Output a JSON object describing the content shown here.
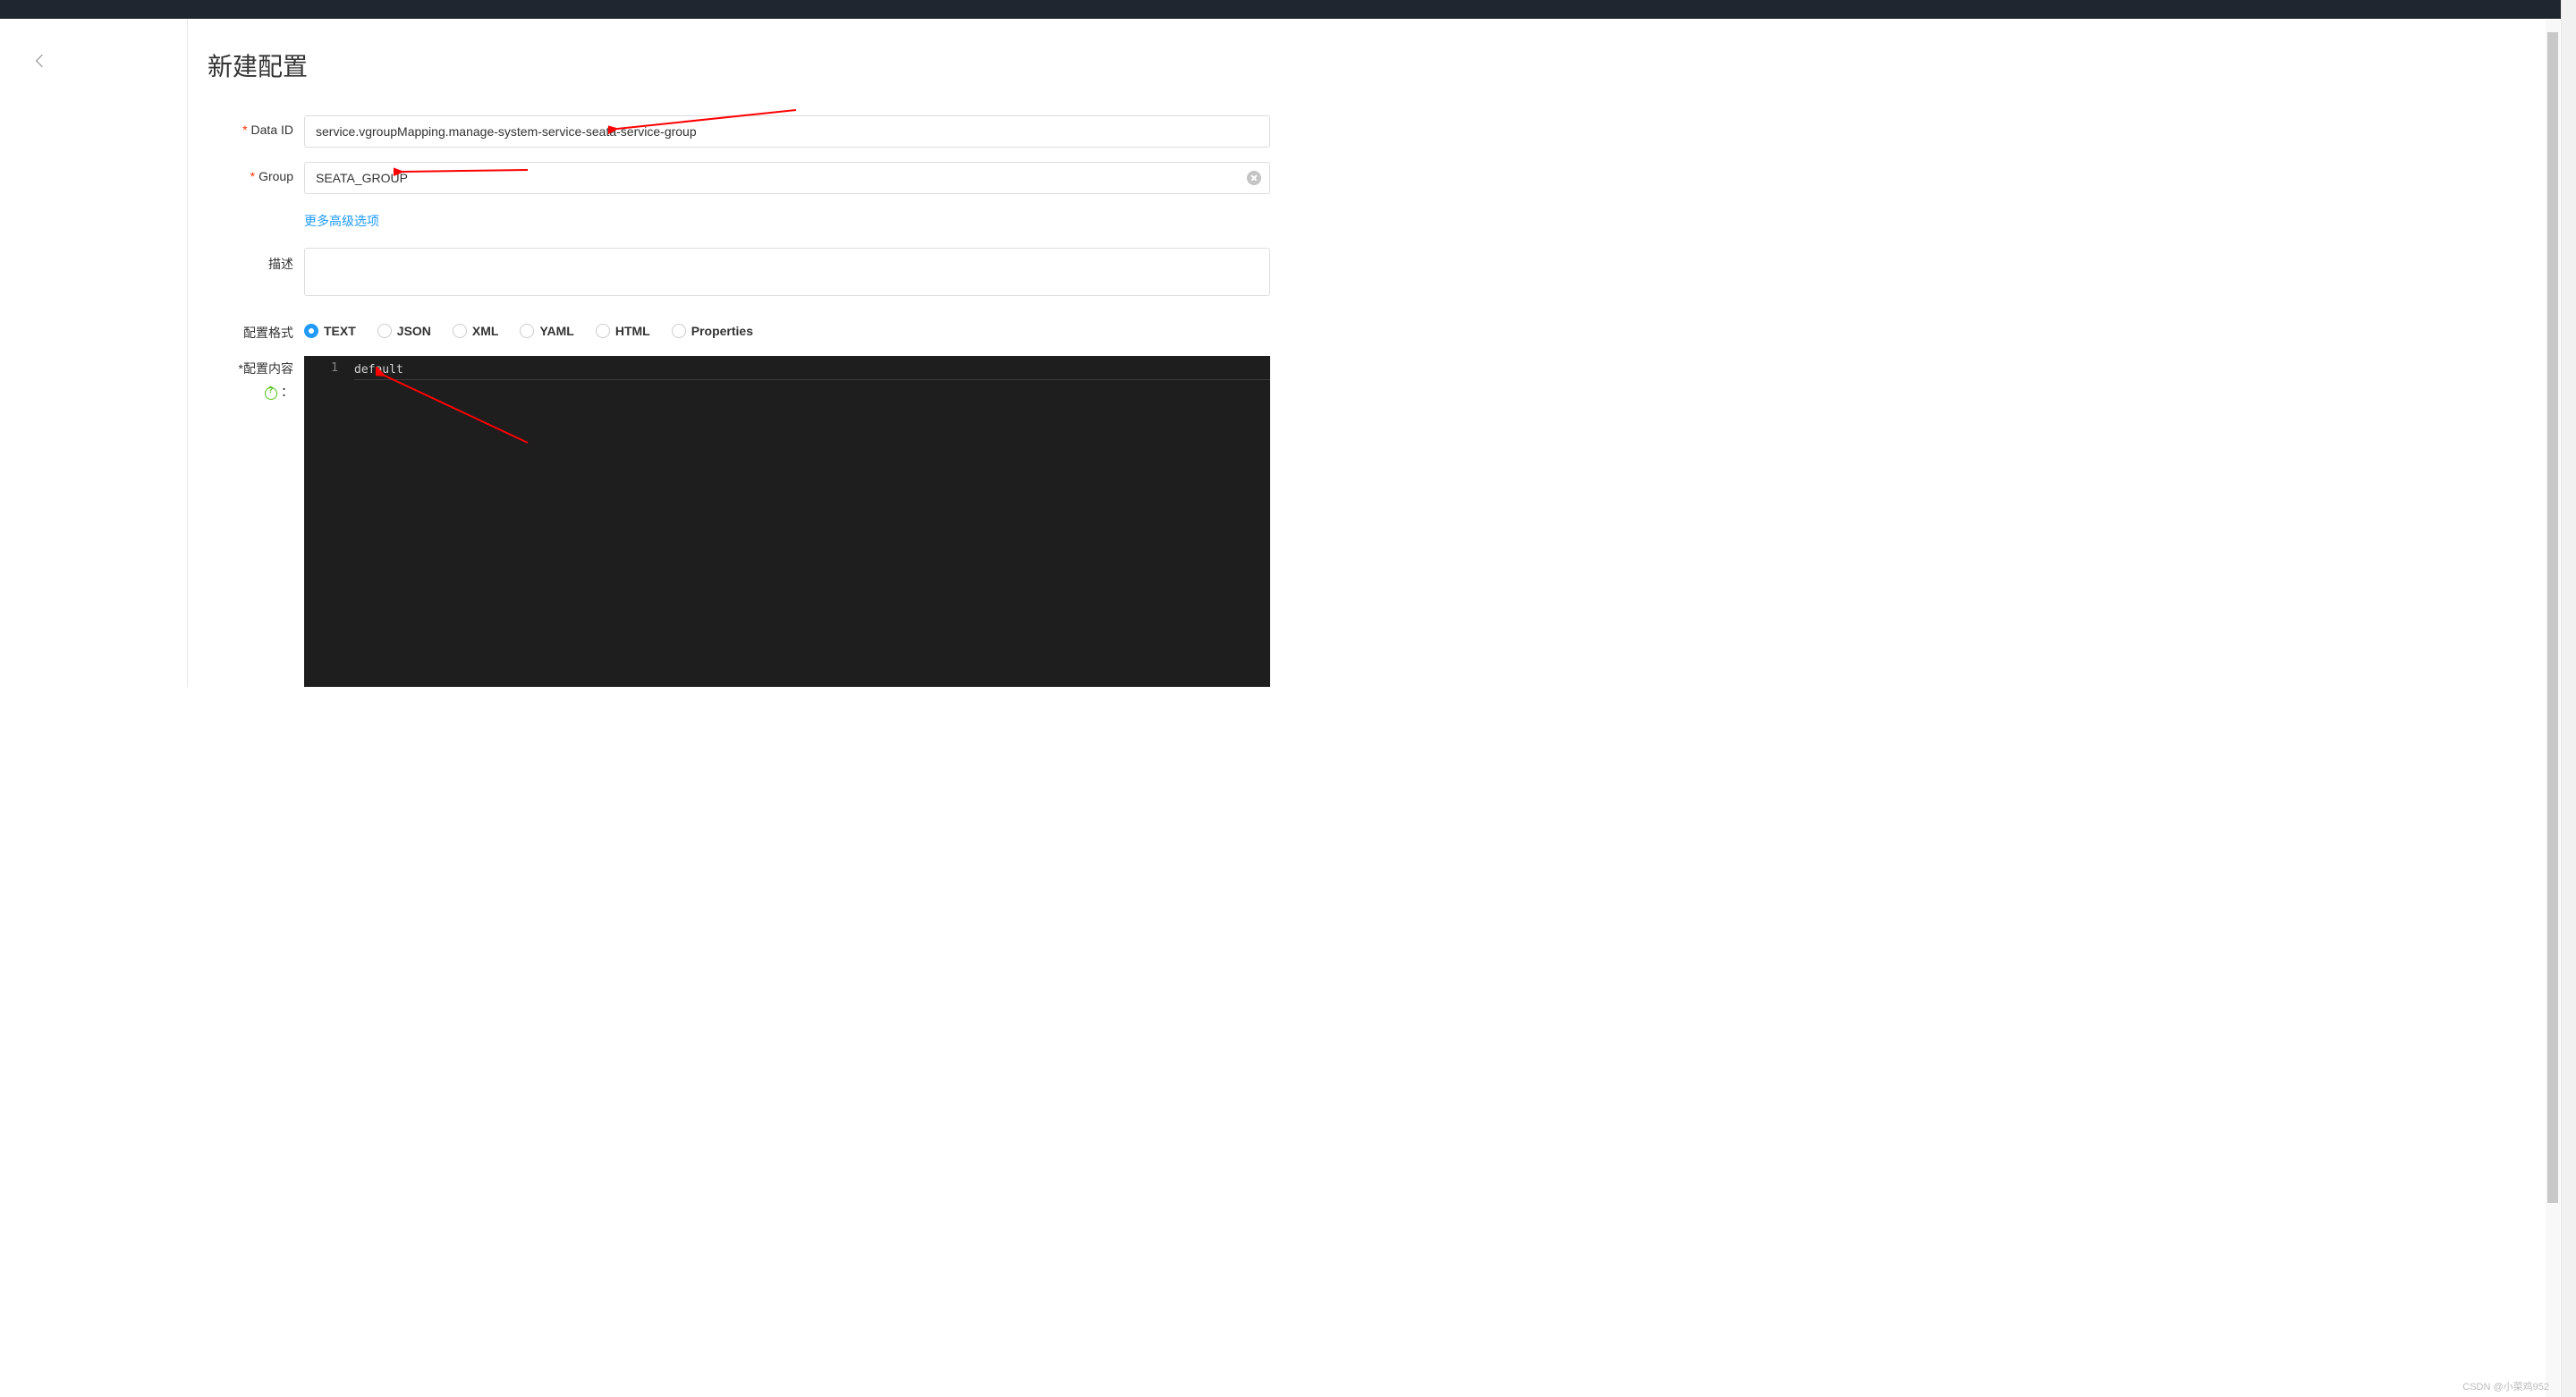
{
  "header": {
    "title": "新建配置"
  },
  "form": {
    "dataId": {
      "label": "Data ID",
      "value": "service.vgroupMapping.manage-system-service-seata-service-group"
    },
    "group": {
      "label": "Group",
      "value": "SEATA_GROUP"
    },
    "advanced": {
      "label": "更多高级选项"
    },
    "description": {
      "label": "描述",
      "value": ""
    },
    "format": {
      "label": "配置格式",
      "selected": "TEXT",
      "options": [
        "TEXT",
        "JSON",
        "XML",
        "YAML",
        "HTML",
        "Properties"
      ]
    },
    "content": {
      "label": "配置内容",
      "colon": "：",
      "lineNumber": "1",
      "value": "default"
    }
  },
  "watermark": "CSDN @小菜鸡952"
}
